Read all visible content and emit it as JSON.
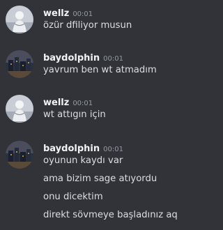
{
  "messages": [
    {
      "author": "wellz",
      "timestamp": "00:01",
      "avatar_icon": "user-avatar-white-figure",
      "lines": [
        "özür dfiliyor musun"
      ]
    },
    {
      "author": "baydolphin",
      "timestamp": "00:01",
      "avatar_icon": "user-avatar-dark-city",
      "lines": [
        "yavrum ben wt atmadım"
      ]
    },
    {
      "author": "wellz",
      "timestamp": "00:01",
      "avatar_icon": "user-avatar-white-figure",
      "lines": [
        "wt attıgın için"
      ]
    },
    {
      "author": "baydolphin",
      "timestamp": "00:01",
      "avatar_icon": "user-avatar-dark-city",
      "lines": [
        "oyunun kaydı var",
        "ama bizim sage atıyordu",
        "onu dicektim",
        "direkt sövmeye başladınız aq"
      ]
    }
  ],
  "colors": {
    "background": "#313338",
    "username": "#f2f3f5",
    "timestamp": "#949ba4",
    "message_text": "#dbdee1"
  }
}
